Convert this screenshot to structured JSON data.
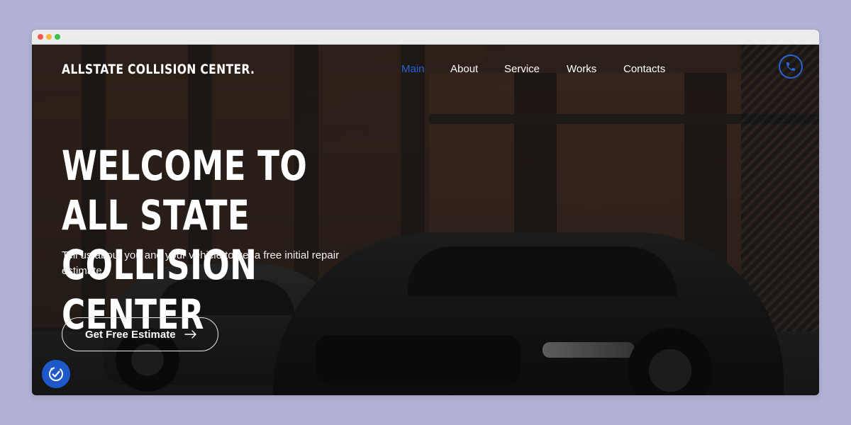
{
  "brand": {
    "logo": "ALLSTATE COLLISION CENTER."
  },
  "nav": {
    "items": [
      {
        "label": "Main",
        "active": true
      },
      {
        "label": "About",
        "active": false
      },
      {
        "label": "Service",
        "active": false
      },
      {
        "label": "Works",
        "active": false
      },
      {
        "label": "Contacts",
        "active": false
      }
    ],
    "phone_icon": "phone-icon"
  },
  "hero": {
    "headline": "WELCOME TO ALL STATE\nCOLLISION CENTER",
    "subtitle": "Tell us about you and your vehicle to get a free initial repair estimate.",
    "cta_label": "Get Free Estimate",
    "cta_icon": "arrow-right-icon"
  },
  "accessibility": {
    "icon": "accessibility-check-icon"
  },
  "colors": {
    "accent": "#2864d8",
    "page_bg": "#b1b1d3"
  }
}
